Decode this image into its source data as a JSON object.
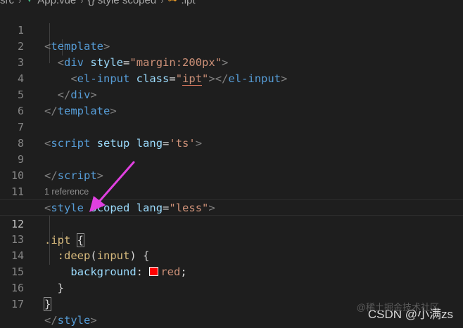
{
  "breadcrumb": {
    "items": [
      "src",
      "App.vue",
      "{} style scoped",
      ".ipt"
    ]
  },
  "editor": {
    "lines": [
      {
        "num": "1"
      },
      {
        "num": "2"
      },
      {
        "num": "3"
      },
      {
        "num": "4"
      },
      {
        "num": "5"
      },
      {
        "num": "6"
      },
      {
        "num": "7"
      },
      {
        "num": "8"
      },
      {
        "num": "9"
      },
      {
        "num": "10"
      },
      {
        "num": "11"
      },
      {
        "num": "12"
      },
      {
        "num": "13"
      },
      {
        "num": "14"
      },
      {
        "num": "15"
      },
      {
        "num": "16"
      },
      {
        "num": "17"
      }
    ],
    "code": {
      "l1_tag": "template",
      "l2_tag": "div",
      "l2_attr": "style",
      "l2_val": "\"margin:200px\"",
      "l3_tag": "el-input",
      "l3_attr": "class",
      "l3_val_q1": "\"",
      "l3_val": "ipt",
      "l3_val_q2": "\"",
      "l3_close": "el-input",
      "l4_tag": "div",
      "l5_tag": "template",
      "l7_tag": "script",
      "l7_attr1": "setup",
      "l7_attr2": "lang",
      "l7_val": "'ts'",
      "l9_tag": "script",
      "l11_tag": "style",
      "l11_attr1": "scoped",
      "l11_attr2": "lang",
      "l11_val": "\"less\"",
      "reference": "1 reference",
      "l12_sel": ".ipt",
      "l13_fn": ":deep",
      "l13_arg": "input",
      "l14_prop": "background",
      "l14_val": "red",
      "l17_tag": "style"
    }
  },
  "annotation": {
    "arrow_color": "#e040e0"
  },
  "colors": {
    "swatch": "#ff0000"
  },
  "watermark": {
    "text": "CSDN @小满zs",
    "faint": "@稀土掘金技术社区"
  }
}
